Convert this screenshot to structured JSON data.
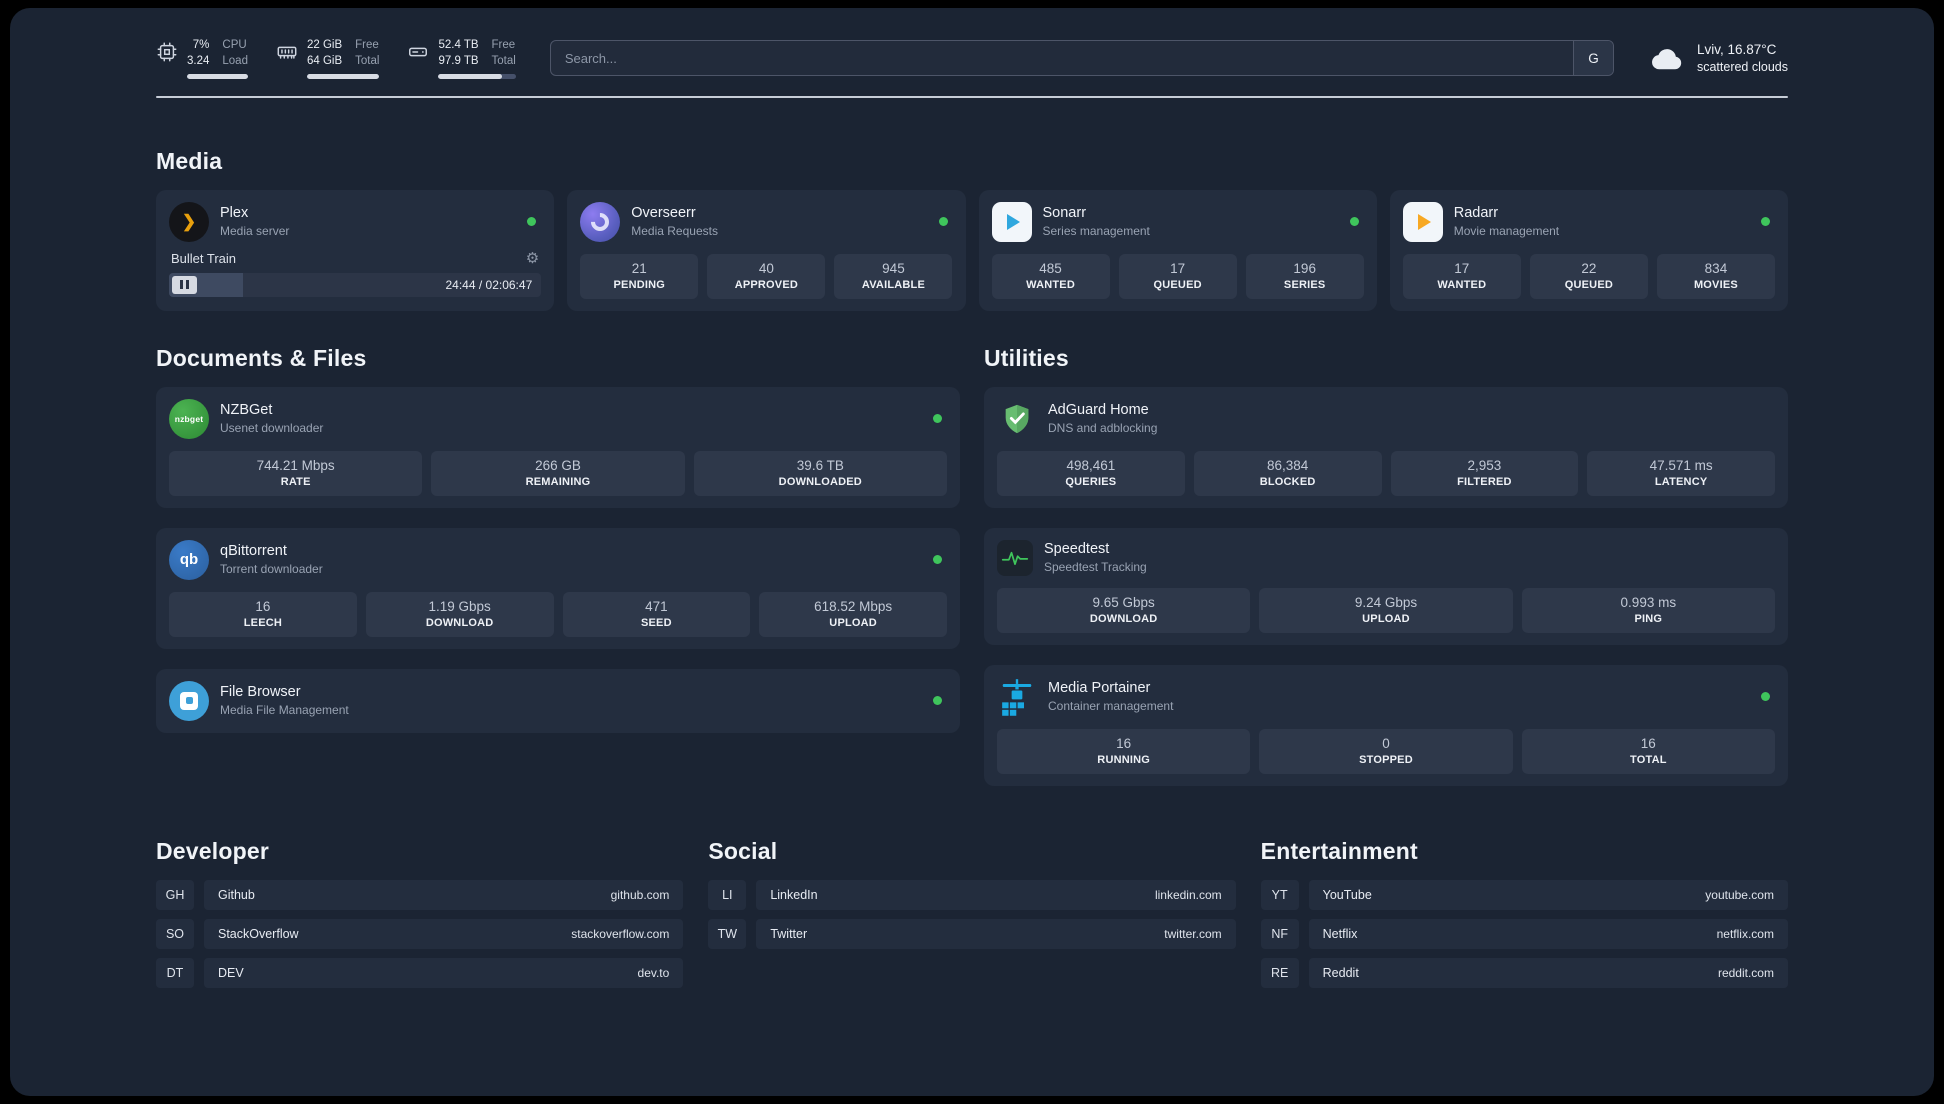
{
  "topbar": {
    "cpu": {
      "usage": "7%",
      "load": "3.24",
      "label_top": "CPU",
      "label_bottom": "Load"
    },
    "ram": {
      "free": "22 GiB",
      "total": "64 GiB",
      "label_top": "Free",
      "label_bottom": "Total"
    },
    "disk": {
      "free": "52.4 TB",
      "total": "97.9 TB",
      "label_top": "Free",
      "label_bottom": "Total"
    },
    "search": {
      "placeholder": "Search...",
      "engine_button": "G"
    },
    "weather": {
      "location": "Lviv, 16.87°C",
      "condition": "scattered clouds"
    }
  },
  "icons": {
    "plex_glyph": "❯",
    "gear": "⚙",
    "nzbget_text": "nzbget",
    "qbittorrent_text": "qb"
  },
  "media": {
    "heading": "Media",
    "plex": {
      "name": "Plex",
      "subtitle": "Media server",
      "now_playing": "Bullet Train",
      "time": "24:44 / 02:06:47"
    },
    "overseerr": {
      "name": "Overseerr",
      "subtitle": "Media Requests",
      "stats": [
        {
          "value": "21",
          "label": "PENDING"
        },
        {
          "value": "40",
          "label": "APPROVED"
        },
        {
          "value": "945",
          "label": "AVAILABLE"
        }
      ]
    },
    "sonarr": {
      "name": "Sonarr",
      "subtitle": "Series management",
      "stats": [
        {
          "value": "485",
          "label": "WANTED"
        },
        {
          "value": "17",
          "label": "QUEUED"
        },
        {
          "value": "196",
          "label": "SERIES"
        }
      ]
    },
    "radarr": {
      "name": "Radarr",
      "subtitle": "Movie management",
      "stats": [
        {
          "value": "17",
          "label": "WANTED"
        },
        {
          "value": "22",
          "label": "QUEUED"
        },
        {
          "value": "834",
          "label": "MOVIES"
        }
      ]
    }
  },
  "documents": {
    "heading": "Documents & Files",
    "nzbget": {
      "name": "NZBGet",
      "subtitle": "Usenet downloader",
      "stats": [
        {
          "value": "744.21 Mbps",
          "label": "RATE"
        },
        {
          "value": "266 GB",
          "label": "REMAINING"
        },
        {
          "value": "39.6 TB",
          "label": "DOWNLOADED"
        }
      ]
    },
    "qbittorrent": {
      "name": "qBittorrent",
      "subtitle": "Torrent downloader",
      "stats": [
        {
          "value": "16",
          "label": "LEECH"
        },
        {
          "value": "1.19 Gbps",
          "label": "DOWNLOAD"
        },
        {
          "value": "471",
          "label": "SEED"
        },
        {
          "value": "618.52 Mbps",
          "label": "UPLOAD"
        }
      ]
    },
    "filebrowser": {
      "name": "File Browser",
      "subtitle": "Media File Management"
    }
  },
  "utilities": {
    "heading": "Utilities",
    "adguard": {
      "name": "AdGuard Home",
      "subtitle": "DNS and adblocking",
      "stats": [
        {
          "value": "498,461",
          "label": "QUERIES"
        },
        {
          "value": "86,384",
          "label": "BLOCKED"
        },
        {
          "value": "2,953",
          "label": "FILTERED"
        },
        {
          "value": "47.571 ms",
          "label": "LATENCY"
        }
      ]
    },
    "speedtest": {
      "name": "Speedtest",
      "subtitle": "Speedtest Tracking",
      "stats": [
        {
          "value": "9.65 Gbps",
          "label": "DOWNLOAD"
        },
        {
          "value": "9.24 Gbps",
          "label": "UPLOAD"
        },
        {
          "value": "0.993 ms",
          "label": "PING"
        }
      ]
    },
    "portainer": {
      "name": "Media Portainer",
      "subtitle": "Container management",
      "stats": [
        {
          "value": "16",
          "label": "RUNNING"
        },
        {
          "value": "0",
          "label": "STOPPED"
        },
        {
          "value": "16",
          "label": "TOTAL"
        }
      ]
    }
  },
  "bookmarks": {
    "developer": {
      "heading": "Developer",
      "items": [
        {
          "badge": "GH",
          "name": "Github",
          "url": "github.com"
        },
        {
          "badge": "SO",
          "name": "StackOverflow",
          "url": "stackoverflow.com"
        },
        {
          "badge": "DT",
          "name": "DEV",
          "url": "dev.to"
        }
      ]
    },
    "social": {
      "heading": "Social",
      "items": [
        {
          "badge": "LI",
          "name": "LinkedIn",
          "url": "linkedin.com"
        },
        {
          "badge": "TW",
          "name": "Twitter",
          "url": "twitter.com"
        }
      ]
    },
    "entertainment": {
      "heading": "Entertainment",
      "items": [
        {
          "badge": "YT",
          "name": "YouTube",
          "url": "youtube.com"
        },
        {
          "badge": "NF",
          "name": "Netflix",
          "url": "netflix.com"
        },
        {
          "badge": "RE",
          "name": "Reddit",
          "url": "reddit.com"
        }
      ]
    }
  },
  "colors": {
    "status_online": "#3fc55c",
    "plex_amber": "#e8a00d",
    "overseerr_purple": "#5a5fc0",
    "sonarr_blue": "#2fa7de",
    "radarr_orange": "#f7a823",
    "nzbget_green": "#3aa442",
    "qbittorrent_blue": "#2f6db5",
    "filebrowser_blue": "#3ea0d8",
    "adguard_green": "#68bd71",
    "portainer_blue": "#1aa9e2"
  }
}
